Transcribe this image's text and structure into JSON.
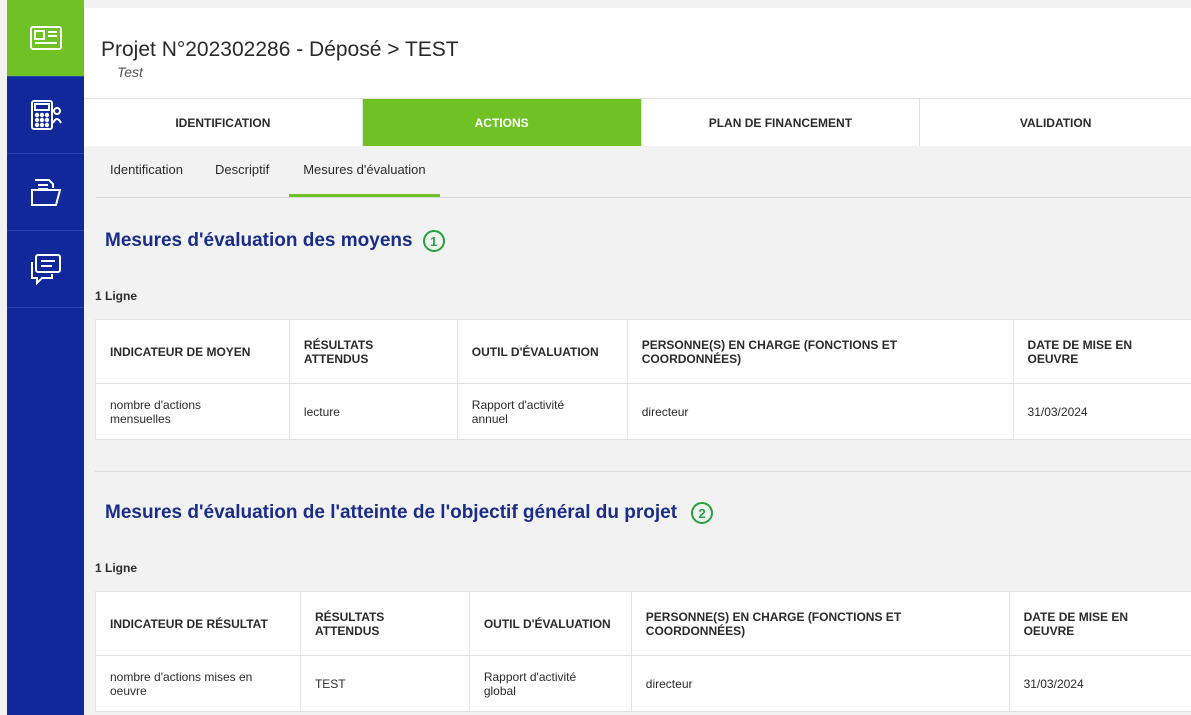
{
  "header": {
    "title": "Projet N°202302286 - Déposé > TEST",
    "subtitle": "Test"
  },
  "sidebar": {
    "items": [
      {
        "icon": "id-card-icon",
        "active": true
      },
      {
        "icon": "calculator-icon",
        "active": false
      },
      {
        "icon": "folder-icon",
        "active": false
      },
      {
        "icon": "chat-icon",
        "active": false
      }
    ]
  },
  "steps": [
    {
      "label": "IDENTIFICATION"
    },
    {
      "label": "ACTIONS"
    },
    {
      "label": "PLAN DE FINANCEMENT"
    },
    {
      "label": "VALIDATION"
    }
  ],
  "subtabs": [
    {
      "label": "Identification"
    },
    {
      "label": "Descriptif"
    },
    {
      "label": "Mesures d'évaluation"
    }
  ],
  "section1": {
    "title": "Mesures d'évaluation des moyens",
    "badge": "1",
    "count": "1 Ligne",
    "headers": [
      "INDICATEUR DE MOYEN",
      "RÉSULTATS ATTENDUS",
      "OUTIL D'ÉVALUATION",
      "PERSONNE(S) EN CHARGE (FONCTIONS ET COORDONNÉES)",
      "DATE DE MISE EN OEUVRE"
    ],
    "rows": [
      [
        "nombre d'actions mensuelles",
        "lecture",
        "Rapport d'activité annuel",
        "directeur",
        "31/03/2024"
      ]
    ]
  },
  "section2": {
    "title": "Mesures d'évaluation de l'atteinte de l'objectif général du projet",
    "badge": "2",
    "count": "1 Ligne",
    "headers": [
      "INDICATEUR DE RÉSULTAT",
      "RÉSULTATS ATTENDUS",
      "OUTIL D'ÉVALUATION",
      "PERSONNE(S) EN CHARGE (FONCTIONS ET COORDONNÉES)",
      "DATE DE MISE EN OEUVRE"
    ],
    "rows": [
      [
        "nombre d'actions mises en oeuvre",
        "TEST",
        "Rapport d'activité global",
        "directeur",
        "31/03/2024"
      ]
    ]
  },
  "colors": {
    "accent_green": "#6fc124",
    "sidebar_blue": "#10289a",
    "title_blue": "#1a2d8a",
    "badge_green": "#23a33c"
  }
}
